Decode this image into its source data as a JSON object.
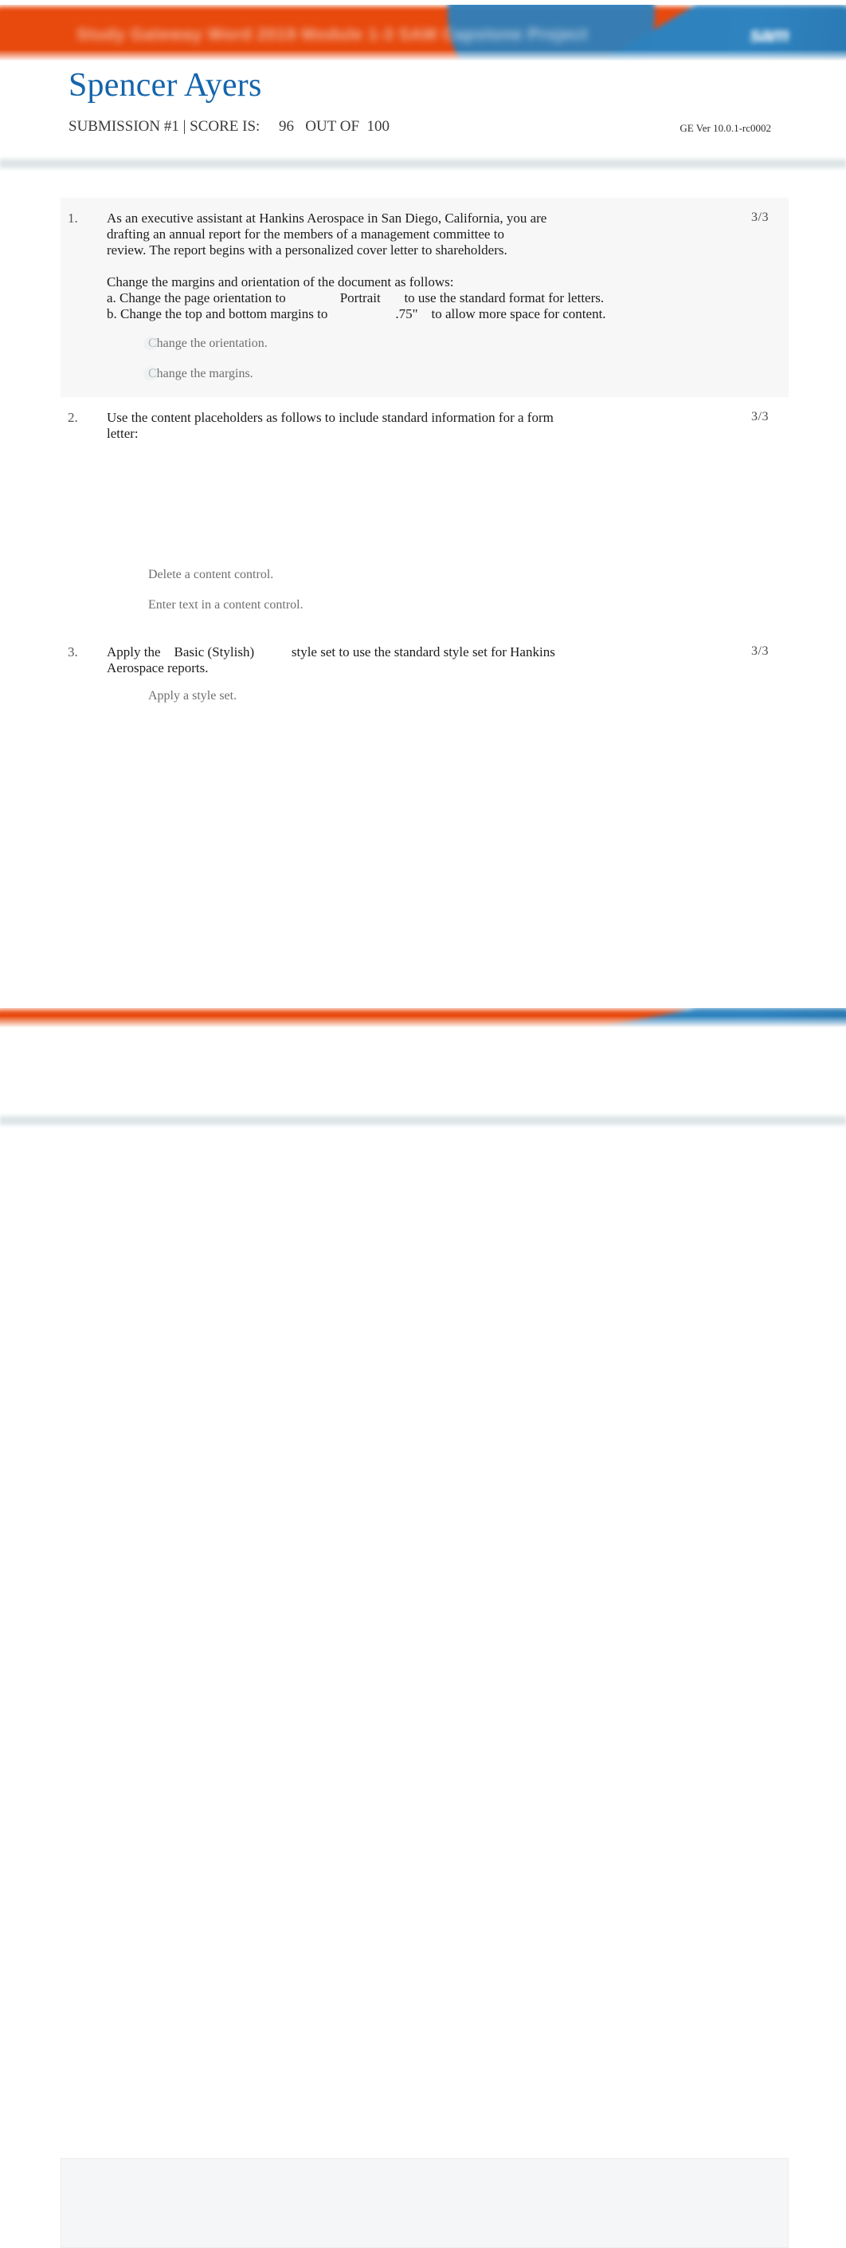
{
  "document": {
    "student_name": "Spencer Ayers",
    "submission_label": "SUBMISSION #1 | SCORE IS:     96   OUT OF  100",
    "submission_number": "1",
    "score": "96",
    "score_out_of": "100",
    "version": "GE Ver 10.0.1-rc0002",
    "banner_title_obscured": "Study Gateway Word 2019 Module 1-3  SAM  Capstone Project",
    "banner_logo_obscured": "sam"
  },
  "colors": {
    "banner_orange": "#e8490d",
    "banner_blue": "#2d81bd",
    "name_blue": "#1565ac",
    "card_shaded": "#f7f7f7",
    "separator": "#dfe6e8"
  },
  "tasks": [
    {
      "number": "1.",
      "score": "3/3",
      "text": "As an executive assistant at Hankins Aerospace in San Diego, California, you are\ndrafting an annual report for the members of a management committee to\nreview. The report begins with a personalized cover letter to shareholders.\n\nChange the margins and orientation of the document as follows:\na. Change the page orientation to                Portrait       to use the standard format for letters.\nb. Change the top and bottom margins to                    .75\"    to allow more space for content.",
      "subitems": [
        {
          "label": "Change the orientation."
        },
        {
          "label": "Change the margins."
        }
      ]
    },
    {
      "number": "2.",
      "score": "3/3",
      "text": "Use the content placeholders as follows to include standard information for a form\nletter:",
      "subitems": [
        {
          "label": "Delete a content control."
        },
        {
          "label": "Enter text in a content control."
        }
      ]
    },
    {
      "number": "3.",
      "score": "3/3",
      "text": "Apply the    Basic (Stylish)           style set to use the standard style set for Hankins\nAerospace reports.",
      "subitems": [
        {
          "label": "Apply a style set."
        }
      ]
    }
  ]
}
